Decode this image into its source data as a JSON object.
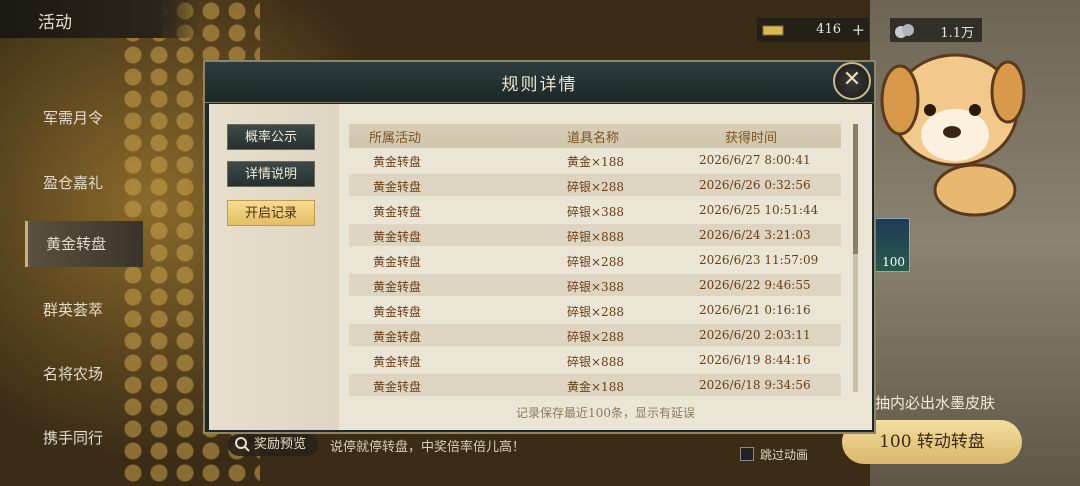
{
  "header": {
    "title": "活动"
  },
  "resources": [
    {
      "icon": "gold-bar-icon",
      "value": "416",
      "plus": "+"
    },
    {
      "icon": "silver-icon",
      "value": "1.1万"
    }
  ],
  "sidebar": {
    "items": [
      {
        "label": "军需月令"
      },
      {
        "label": "盈仓嘉礼"
      },
      {
        "label": "黄金转盘"
      },
      {
        "label": "群英荟萃"
      },
      {
        "label": "名将农场"
      },
      {
        "label": "携手同行"
      }
    ]
  },
  "item_badge": "100",
  "promo_text": "抽内必出水墨皮肤",
  "spin_button": "100 转动转盘",
  "skip_label": "跳过动画",
  "reward_preview": "奖励预览",
  "ticker": "说停就停转盘，中奖倍率倍儿高！",
  "dialog": {
    "title": "规则详情",
    "close": "✕",
    "tabs": [
      {
        "label": "概率公示"
      },
      {
        "label": "详情说明"
      },
      {
        "label": "开启记录"
      }
    ],
    "table": {
      "headers": [
        "所属活动",
        "道具名称",
        "获得时间"
      ],
      "rows": [
        [
          "黄金转盘",
          "黄金×188",
          "2026/6/27 8:00:41"
        ],
        [
          "黄金转盘",
          "碎银×288",
          "2026/6/26 0:32:56"
        ],
        [
          "黄金转盘",
          "碎银×388",
          "2026/6/25 10:51:44"
        ],
        [
          "黄金转盘",
          "碎银×888",
          "2026/6/24 3:21:03"
        ],
        [
          "黄金转盘",
          "碎银×288",
          "2026/6/23 11:57:09"
        ],
        [
          "黄金转盘",
          "碎银×388",
          "2026/6/22 9:46:55"
        ],
        [
          "黄金转盘",
          "碎银×288",
          "2026/6/21 0:16:16"
        ],
        [
          "黄金转盘",
          "碎银×288",
          "2026/6/20 2:03:11"
        ],
        [
          "黄金转盘",
          "碎银×888",
          "2026/6/19 8:44:16"
        ],
        [
          "黄金转盘",
          "黄金×188",
          "2026/6/18 9:34:56"
        ]
      ]
    },
    "note": "记录保存最近100条，显示有延误"
  },
  "colors": {
    "accent_gold": "#e3bd62",
    "dialog_bg": "#ebe5d6",
    "text_brown": "#6a3e14"
  }
}
